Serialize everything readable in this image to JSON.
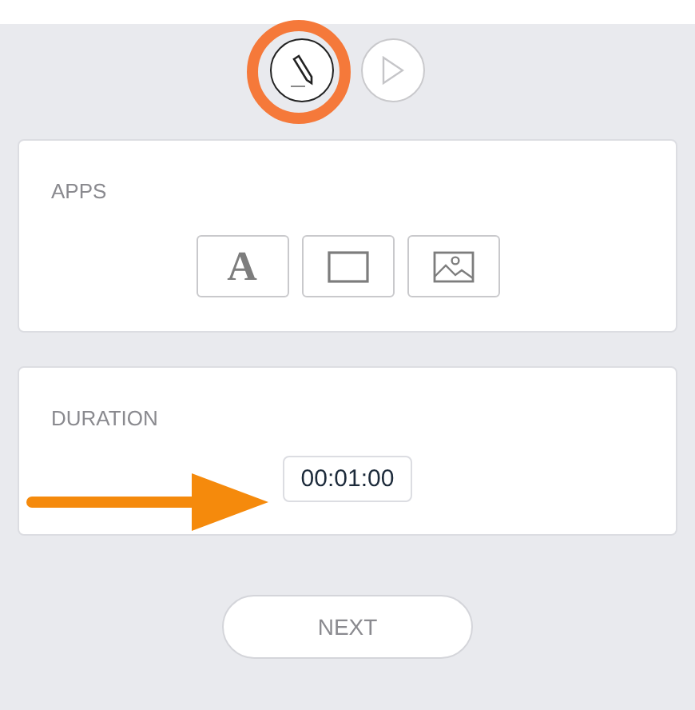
{
  "tools": [
    {
      "kind": "edit",
      "selected": true
    },
    {
      "kind": "play",
      "selected": false
    }
  ],
  "apps": {
    "title": "APPS",
    "items": [
      {
        "kind": "text",
        "glyph": "A"
      },
      {
        "kind": "shape"
      },
      {
        "kind": "image"
      }
    ]
  },
  "duration": {
    "title": "DURATION",
    "value": "00:01:00"
  },
  "next_button": "NEXT"
}
